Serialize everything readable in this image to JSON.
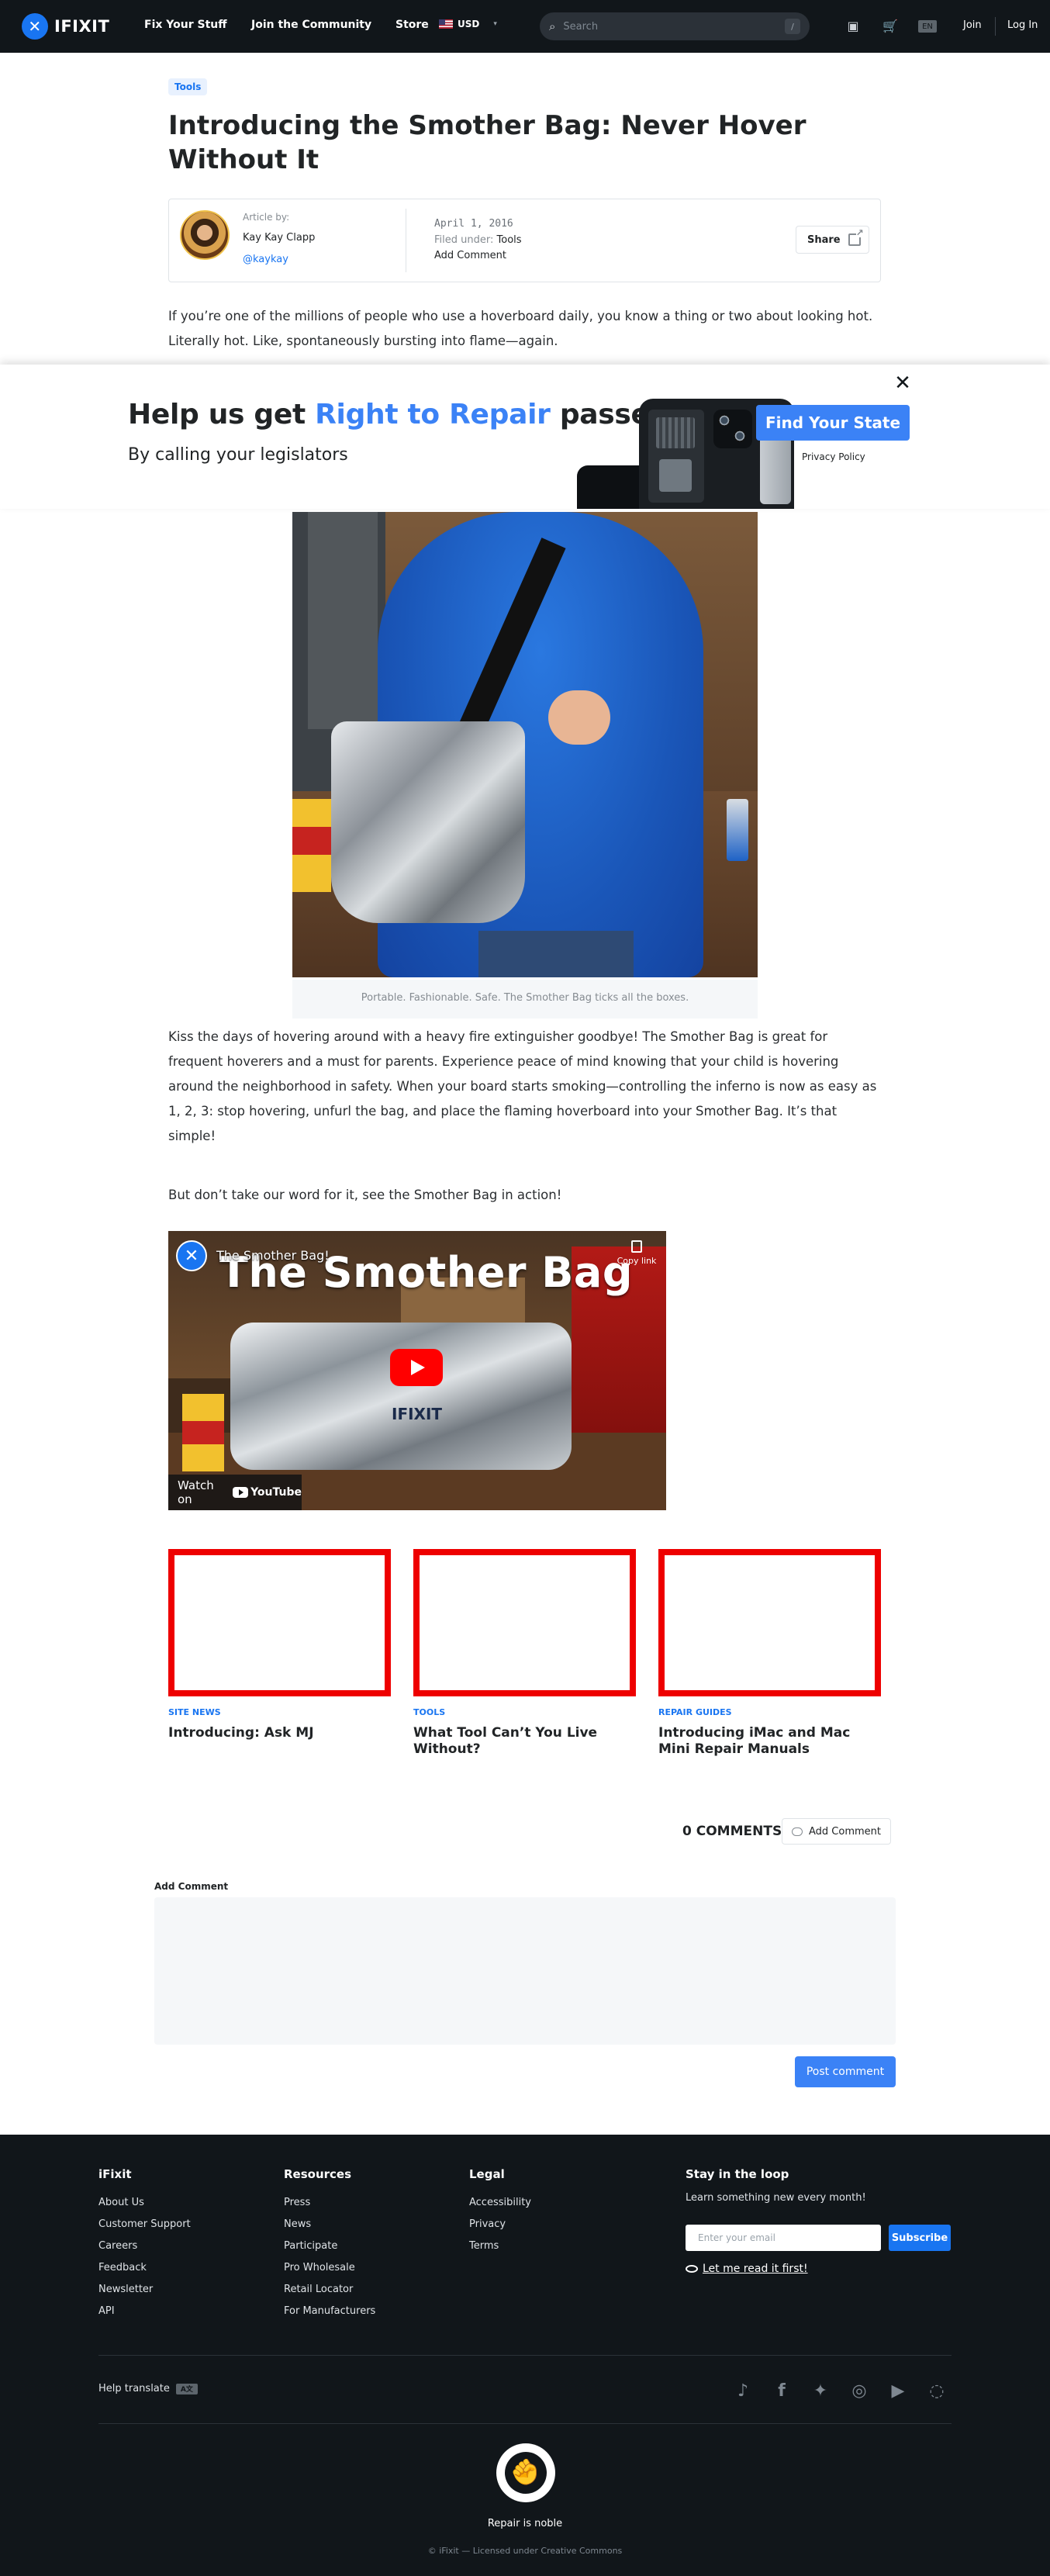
{
  "header": {
    "logo_text": "IFIXIT",
    "nav": [
      "Fix Your Stuff",
      "Join the Community",
      "Store"
    ],
    "currency": "USD",
    "search_placeholder": "Search",
    "search_shortcut": "/",
    "language": "EN",
    "join": "Join",
    "login": "Log In"
  },
  "article": {
    "tag": "Tools",
    "title": "Introducing the Smother Bag: Never Hover Without It",
    "byline": {
      "label": "Article by:",
      "author": "Kay Kay Clapp",
      "handle": "@kaykay",
      "date": "April 1, 2016",
      "filed_label": "Filed under:",
      "filed_value": "Tools",
      "add_comment": "Add Comment",
      "share": "Share"
    },
    "intro": "If you’re one of the millions of people who use a hoverboard daily, you know a thing or two about looking hot. Literally hot. Like, spontaneously bursting into flame—again.",
    "image_caption": "Portable. Fashionable. Safe. The Smother Bag ticks all the boxes.",
    "body1": "Kiss the days of hovering around with a heavy fire extinguisher goodbye! The Smother Bag is great for frequent hoverers and a must for parents. Experience peace of mind knowing that your child is hovering around the neighborhood in safety. When your board starts smoking—controlling the inferno is now as easy as 1, 2, 3: stop hovering, unfurl the bag, and place the flaming hoverboard into your Smother Bag. It’s that simple!",
    "body2": "But don’t take our word for it, see the Smother Bag in action!"
  },
  "banner": {
    "heading_pre": "Help us get ",
    "heading_accent": "Right to Repair",
    "heading_post": " passed",
    "subheading": "By calling your legislators",
    "cta": "Find Your State",
    "privacy": "Privacy Policy",
    "accent_color": "#3b82f6"
  },
  "video": {
    "title": "The Smother Bag!",
    "overlay_title": "The Smother Bag",
    "copy_link": "Copy link",
    "watch_on": "Watch on",
    "youtube": "YouTube",
    "brand": "IFIXIT"
  },
  "related": [
    {
      "category": "SITE NEWS",
      "title": "Introducing: Ask MJ"
    },
    {
      "category": "TOOLS",
      "title": "What Tool Can’t You Live Without?"
    },
    {
      "category": "REPAIR GUIDES",
      "title": "Introducing iMac and Mac Mini Repair Manuals"
    }
  ],
  "comments": {
    "count_label": "0 COMMENTS",
    "add_button": "Add Comment",
    "form_label": "Add Comment",
    "post_button": "Post comment"
  },
  "footer": {
    "col1": {
      "heading": "iFixit",
      "links": [
        "About Us",
        "Customer Support",
        "Careers",
        "Feedback",
        "Newsletter",
        "API"
      ]
    },
    "col2": {
      "heading": "Resources",
      "links": [
        "Press",
        "News",
        "Participate",
        "Pro Wholesale",
        "Retail Locator",
        "For Manufacturers"
      ]
    },
    "col3": {
      "heading": "Legal",
      "links": [
        "Accessibility",
        "Privacy",
        "Terms"
      ]
    },
    "newsletter": {
      "heading": "Stay in the loop",
      "text": "Learn something new every month!",
      "email_placeholder": "Enter your email",
      "subscribe": "Subscribe",
      "read_first": "Let me read it first!"
    },
    "help_translate": "Help translate",
    "social_icons": [
      "tiktok-icon",
      "facebook-icon",
      "twitter-icon",
      "instagram-icon",
      "youtube-icon",
      "repair-org-icon"
    ],
    "motto": "Repair is noble",
    "copyright": "© iFixit — Licensed under Creative Commons"
  },
  "colors": {
    "brand_blue": "#1975f1",
    "header_bg": "#11161a",
    "related_border": "#ee0000"
  }
}
